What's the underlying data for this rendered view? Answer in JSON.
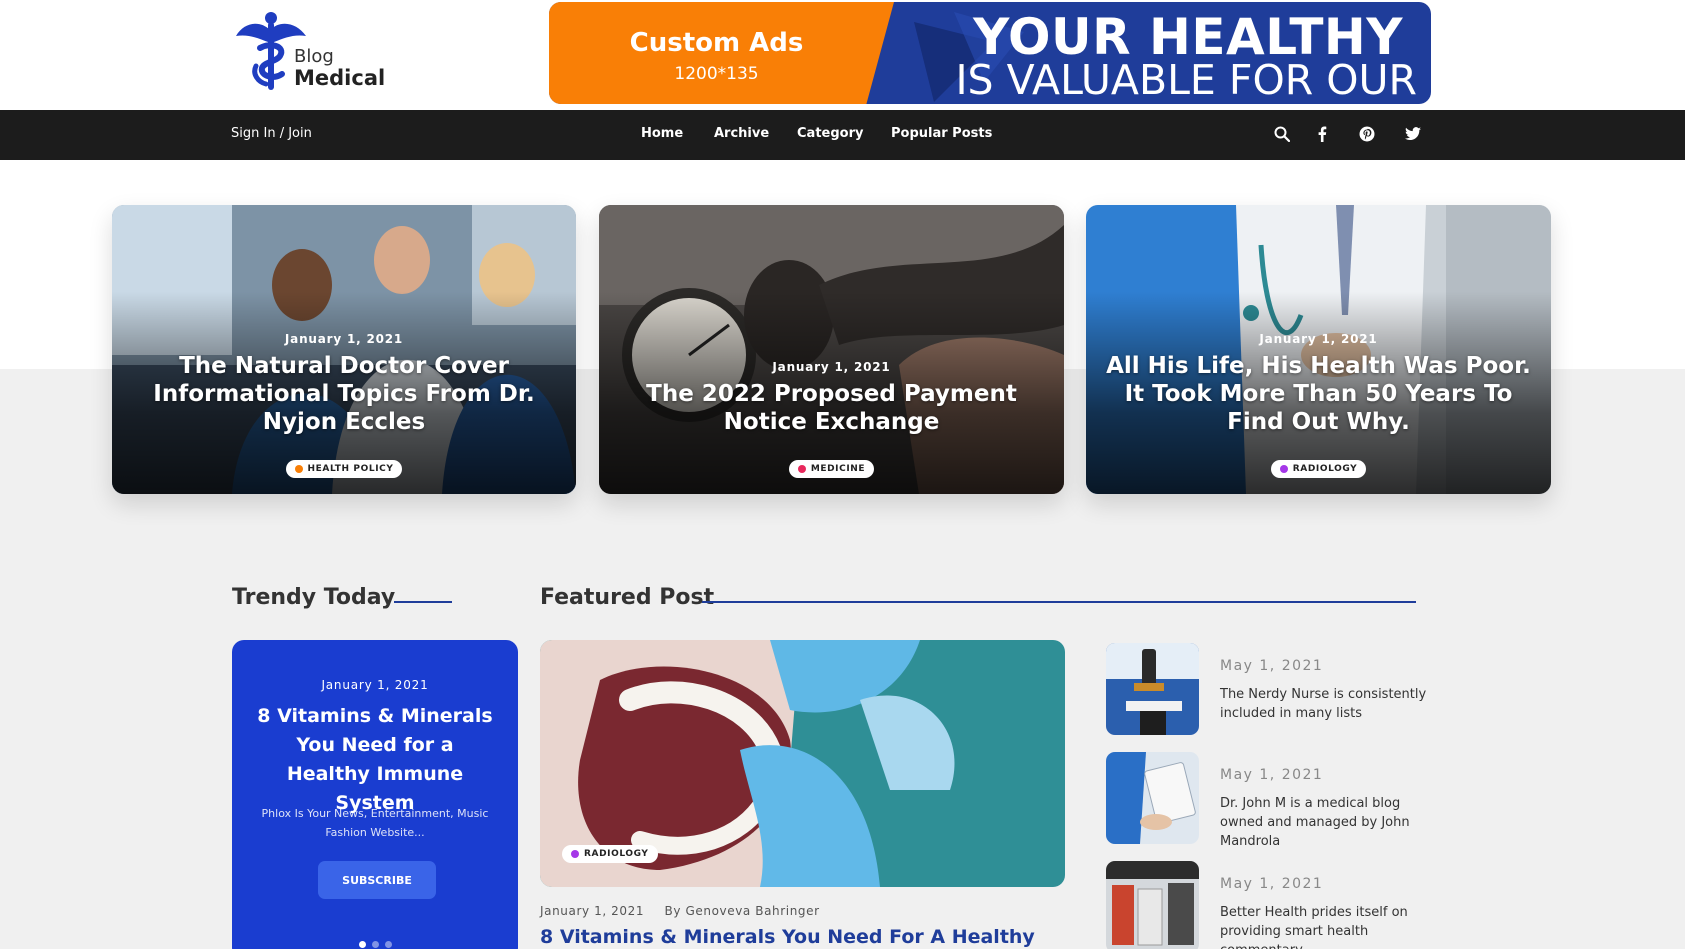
{
  "logo": {
    "line1": "Blog",
    "line2": "Medical",
    "icon": "caduceus-icon"
  },
  "ad": {
    "title": "Custom Ads",
    "size": "1200*135",
    "headline1": "YOUR HEALTHY",
    "headline2": "IS VALUABLE FOR OUR"
  },
  "nav": {
    "signin": "Sign In / Join",
    "links": [
      "Home",
      "Archive",
      "Category",
      "Popular Posts"
    ],
    "icons": [
      "search-icon",
      "facebook-icon",
      "pinterest-icon",
      "twitter-icon"
    ]
  },
  "hero": [
    {
      "date": "January 1, 2021",
      "title": "The Natural Doctor Cover Informational Topics From Dr. Nyjon Eccles",
      "category": "HEALTH POLICY",
      "dot_color": "#f97f06"
    },
    {
      "date": "January 1, 2021",
      "title": "The 2022 Proposed Payment Notice Exchange",
      "category": "MEDICINE",
      "dot_color": "#e8285c"
    },
    {
      "date": "January 1, 2021",
      "title": "All His Life, His Health Was Poor. It Took More Than 50 Years To Find Out Why.",
      "category": "RADIOLOGY",
      "dot_color": "#a537e8"
    }
  ],
  "sections": {
    "trendy": "Trendy Today",
    "featured": "Featured Post"
  },
  "trendy": {
    "date": "January 1, 2021",
    "title": "8 Vitamins & Minerals You Need for a Healthy Immune System",
    "desc": "Phlox Is Your News, Entertainment, Music Fashion Website...",
    "button": "SUBSCRIBE",
    "slides": 3,
    "active_slide": 1
  },
  "featured": {
    "category": "RADIOLOGY",
    "date": "January 1, 2021",
    "author": "By Genoveva Bahringer",
    "title": "8 Vitamins & Minerals You Need For A Healthy"
  },
  "side": [
    {
      "date": "May 1, 2021",
      "text": "The Nerdy Nurse is consistently included in many lists"
    },
    {
      "date": "May 1, 2021",
      "text": "Dr. John M is a medical blog owned and managed by John Mandrola"
    },
    {
      "date": "May 1, 2021",
      "text": "Better Health prides itself on providing smart health commentary."
    }
  ],
  "colors": {
    "brand_blue": "#1f3d9a",
    "ad_orange": "#f97f06",
    "trendy_blue": "#1a3dd0",
    "navbar": "#1c1c1c"
  }
}
